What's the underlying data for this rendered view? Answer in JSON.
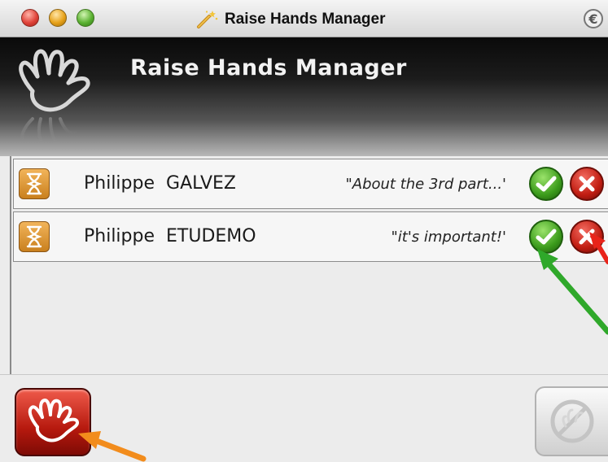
{
  "window": {
    "title": "Raise Hands Manager",
    "ext_glyph": "€"
  },
  "header": {
    "title": "Raise Hands Manager"
  },
  "requests": [
    {
      "first_name": "Philippe",
      "last_name": "GALVEZ",
      "comment": "\"About the 3rd part...'"
    },
    {
      "first_name": "Philippe",
      "last_name": "ETUDEMO",
      "comment": "\"it's important!'"
    }
  ],
  "icons": {
    "header": "raised-hand-icon",
    "status": "hourglass-icon",
    "accept": "checkmark-icon",
    "reject": "x-icon",
    "lower_all": "raised-hand-icon",
    "disabled": "no-hand-icon"
  },
  "colors": {
    "accept": "#3c9c1c",
    "reject": "#c11d12",
    "hourglass": "#e09a35",
    "annotation_green": "#2fa82a",
    "annotation_red": "#e8231a",
    "annotation_orange": "#f28c1c"
  }
}
